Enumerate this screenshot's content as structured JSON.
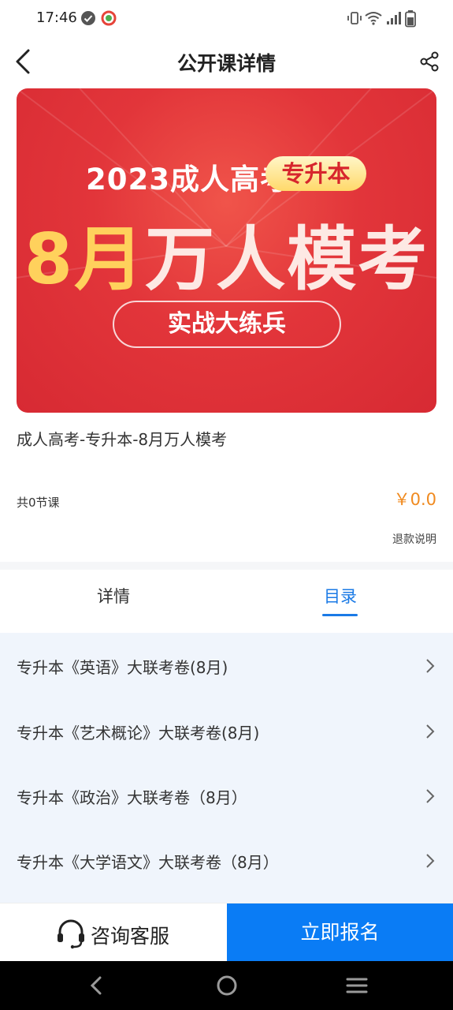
{
  "status_bar": {
    "time": "17:46",
    "icons": [
      "check-circle-icon",
      "app-badge-icon",
      "vibrate-icon",
      "wifi-icon",
      "signal-icon",
      "battery-icon"
    ]
  },
  "header": {
    "title": "公开课详情",
    "back_icon": "back-chevron-icon",
    "share_icon": "share-icon"
  },
  "banner": {
    "year_line": "2023成人高考",
    "tag": "专升本",
    "headline_highlight": "8月",
    "headline_rest": "万人模考",
    "button_text": "实战大练兵",
    "colors": {
      "background": "#e2353a",
      "gold": "#ffd15c",
      "tag_text": "#d7262d"
    }
  },
  "course": {
    "title": "成人高考-专升本-8月万人模考",
    "lesson_count": "共0节课",
    "price": "￥0.0",
    "refund_link": "退款说明"
  },
  "tabs": [
    {
      "label": "详情",
      "active": false
    },
    {
      "label": "目录",
      "active": true
    }
  ],
  "catalog": [
    {
      "label": "专升本《英语》大联考卷(8月)"
    },
    {
      "label": "专升本《艺术概论》大联考卷(8月)"
    },
    {
      "label": "专升本《政治》大联考卷（8月）"
    },
    {
      "label": "专升本《大学语文》大联考卷（8月）"
    }
  ],
  "bottom_bar": {
    "consult_label": "咨询客服",
    "signup_label": "立即报名",
    "accent_color": "#0a7cf5"
  },
  "system_nav": [
    "nav-back-icon",
    "nav-home-icon",
    "nav-menu-icon"
  ]
}
